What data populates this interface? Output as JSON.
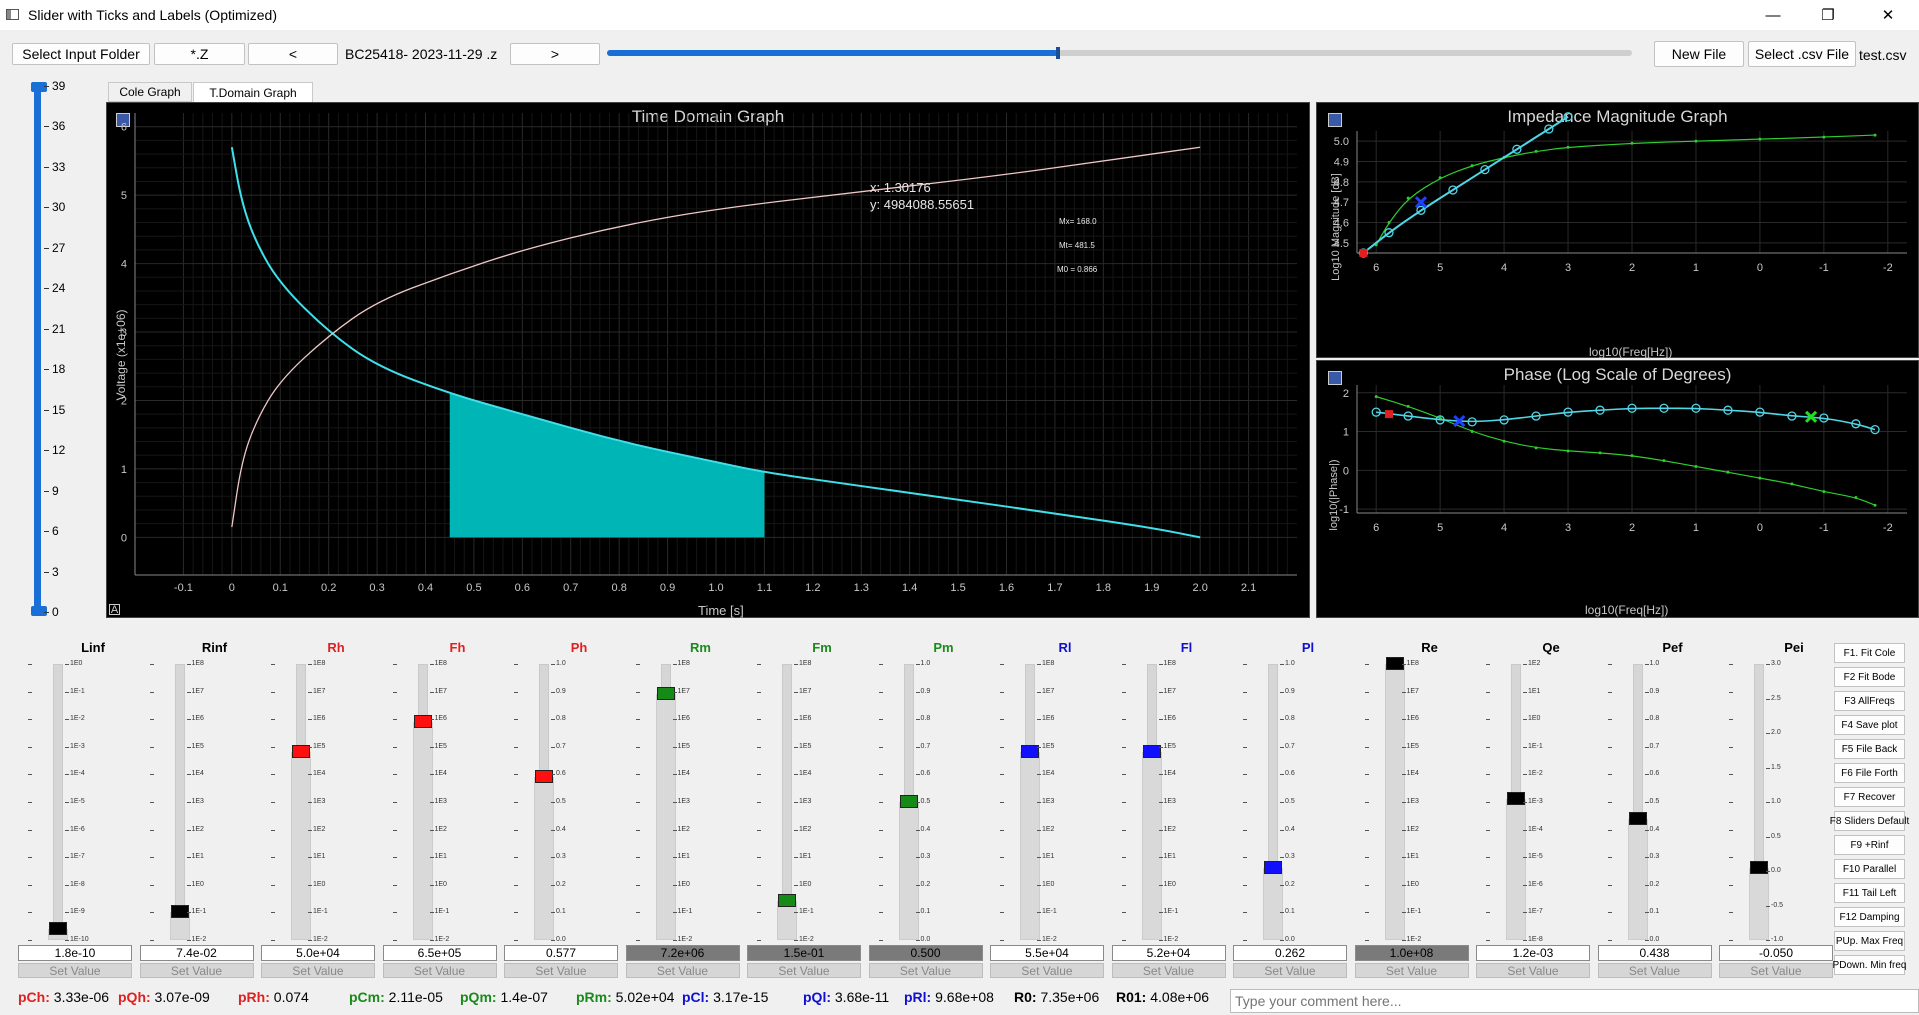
{
  "window": {
    "title": "Slider with Ticks and Labels (Optimized)",
    "minimize": "—",
    "maximize": "❐",
    "close": "✕"
  },
  "toolbar": {
    "select_input_folder": "Select Input Folder",
    "ext_z": "*.Z",
    "prev": "<",
    "file_name": "BC25418- 2023-11-29 .z",
    "next": ">",
    "file_progress": 0.44,
    "new_file": "New File",
    "select_csv": "Select .csv File",
    "csv_name": "test.csv"
  },
  "main_slider": {
    "ticks": [
      "39",
      "36",
      "33",
      "30",
      "27",
      "24",
      "21",
      "18",
      "15",
      "12",
      "9",
      "6",
      "3",
      "0"
    ],
    "value": 39
  },
  "tabs": [
    "Cole Graph",
    "T.Domain Graph"
  ],
  "time_graph": {
    "title": "Time Domain Graph",
    "xlabel": "Time [s]",
    "ylabel": "Voltage (x1e+06)",
    "cursor_x": "x: 1.30176",
    "cursor_y": "y: 4984088.55651",
    "note_mx": "Mx= 168.0",
    "note_mt": "Mt= 481.5",
    "note_m0": "M0 = 0.866",
    "xticks": [
      "-0.1",
      "0",
      "0.1",
      "0.2",
      "0.3",
      "0.4",
      "0.5",
      "0.6",
      "0.7",
      "0.8",
      "0.9",
      "1.0",
      "1.1",
      "1.2",
      "1.3",
      "1.4",
      "1.5",
      "1.6",
      "1.7",
      "1.8",
      "1.9",
      "2.0",
      "2.1"
    ],
    "yticks": [
      "0",
      "1",
      "2",
      "3",
      "4",
      "5",
      "6"
    ],
    "corner": "A"
  },
  "chart_data": [
    {
      "type": "line",
      "title": "Time Domain Graph",
      "xlabel": "Time [s]",
      "ylabel": "Voltage (x1e+06)",
      "xlim": [
        -0.2,
        2.2
      ],
      "ylim": [
        -0.55,
        6.2
      ],
      "series": [
        {
          "color": "#3fe0ea",
          "x": [
            0.0,
            0.02,
            0.05,
            0.1,
            0.2,
            0.3,
            0.45,
            0.6,
            0.8,
            1.0,
            1.1,
            1.3,
            1.5,
            1.7,
            1.9,
            2.0
          ],
          "y": [
            5.7,
            4.9,
            4.3,
            3.7,
            3.0,
            2.5,
            2.1,
            1.8,
            1.4,
            1.1,
            0.95,
            0.75,
            0.55,
            0.35,
            0.14,
            0.0
          ]
        },
        {
          "color": "#f0c8c8",
          "x": [
            0.0,
            0.02,
            0.05,
            0.1,
            0.2,
            0.3,
            0.45,
            0.6,
            0.8,
            1.0,
            1.3,
            1.6,
            1.8,
            2.0
          ],
          "y": [
            0.15,
            1.1,
            1.7,
            2.3,
            2.95,
            3.45,
            3.85,
            4.2,
            4.55,
            4.8,
            5.05,
            5.3,
            5.5,
            5.7
          ]
        }
      ],
      "shaded": {
        "x0": 0.45,
        "x1": 1.1,
        "color": "#00b5b5"
      }
    },
    {
      "type": "line",
      "title": "Impedance Magnitude Graph",
      "xlabel": "log10(Freq[Hz])",
      "ylabel": "Log10 Magnitude [dB]",
      "xlim": [
        6.3,
        -2.3
      ],
      "ylim": [
        4.45,
        5.05
      ],
      "series": [
        {
          "color": "#2ecc2e",
          "x": [
            6.0,
            5.8,
            5.5,
            5.0,
            4.5,
            4.0,
            3.5,
            3.0,
            2.0,
            1.0,
            0.0,
            -1.0,
            -1.8
          ],
          "y": [
            4.49,
            4.6,
            4.72,
            4.82,
            4.88,
            4.92,
            4.95,
            4.97,
            4.99,
            5.0,
            5.01,
            5.02,
            5.03
          ]
        },
        {
          "color": "#4fd7e8",
          "x": [
            6.2,
            5.8,
            5.3,
            4.8,
            4.3,
            3.8,
            3.3,
            3.0
          ],
          "y": [
            4.45,
            4.55,
            4.66,
            4.76,
            4.86,
            4.96,
            5.06,
            5.12
          ]
        }
      ]
    },
    {
      "type": "line",
      "title": "Phase (Log Scale of Degrees)",
      "xlabel": "log10(Freq[Hz])",
      "ylabel": "log10(|Phase|)",
      "xlim": [
        6.3,
        -2.3
      ],
      "ylim": [
        -1.1,
        2.2
      ],
      "series": [
        {
          "color": "#2ecc2e",
          "x": [
            6.0,
            5.5,
            5.0,
            4.5,
            4.0,
            3.5,
            3.0,
            2.5,
            2.0,
            1.5,
            1.0,
            0.5,
            0.0,
            -0.5,
            -1.0,
            -1.5,
            -1.8
          ],
          "y": [
            1.9,
            1.65,
            1.35,
            1.0,
            0.75,
            0.58,
            0.5,
            0.45,
            0.38,
            0.25,
            0.1,
            -0.05,
            -0.2,
            -0.35,
            -0.55,
            -0.7,
            -0.9
          ]
        },
        {
          "color": "#4fd7e8",
          "x": [
            6.0,
            5.5,
            5.0,
            4.5,
            4.0,
            3.5,
            3.0,
            2.5,
            2.0,
            1.5,
            1.0,
            0.5,
            0.0,
            -0.5,
            -1.0,
            -1.5,
            -1.8
          ],
          "y": [
            1.5,
            1.4,
            1.3,
            1.25,
            1.3,
            1.4,
            1.5,
            1.55,
            1.6,
            1.6,
            1.6,
            1.55,
            1.5,
            1.4,
            1.35,
            1.2,
            1.05
          ]
        }
      ]
    }
  ],
  "imp_graph": {
    "title": "Impedance Magnitude Graph",
    "xlabel": "log10(Freq[Hz])",
    "ylabel": "Log10 Magnitude [dB]",
    "xticks": [
      "6",
      "5",
      "4",
      "3",
      "2",
      "1",
      "0",
      "-1",
      "-2"
    ],
    "yticks": [
      "4.5",
      "4.6",
      "4.7",
      "4.8",
      "4.9",
      "5.0"
    ]
  },
  "phase_graph": {
    "title": "Phase (Log Scale of Degrees)",
    "xlabel": "log10(Freq[Hz])",
    "ylabel": "log10(|Phase|)",
    "xticks": [
      "6",
      "5",
      "4",
      "3",
      "2",
      "1",
      "0",
      "-1",
      "-2"
    ],
    "yticks": [
      "2",
      "1",
      "0",
      "-1"
    ]
  },
  "params": [
    {
      "name": "Linf",
      "color": "#000000",
      "handle": "#000000",
      "pos": 0.96,
      "value": "1.8e-10",
      "dark": false,
      "labels": [
        "1E0",
        "1E-1",
        "1E-2",
        "1E-3",
        "1E-4",
        "1E-5",
        "1E-6",
        "1E-7",
        "1E-8",
        "1E-9",
        "1E-10"
      ]
    },
    {
      "name": "Rinf",
      "color": "#000000",
      "handle": "#000000",
      "pos": 0.9,
      "value": "7.4e-02",
      "dark": false,
      "labels": [
        "1E8",
        "1E7",
        "1E6",
        "1E5",
        "1E4",
        "1E3",
        "1E2",
        "1E1",
        "1E0",
        "1E-1",
        "1E-2"
      ]
    },
    {
      "name": "Rh",
      "color": "#e02020",
      "handle": "#ff1010",
      "pos": 0.32,
      "value": "5.0e+04",
      "dark": false,
      "labels": [
        "1E8",
        "1E7",
        "1E6",
        "1E5",
        "1E4",
        "1E3",
        "1E2",
        "1E1",
        "1E0",
        "1E-1",
        "1E-2"
      ]
    },
    {
      "name": "Fh",
      "color": "#e02020",
      "handle": "#ff1010",
      "pos": 0.21,
      "value": "6.5e+05",
      "dark": false,
      "labels": [
        "1E8",
        "1E7",
        "1E6",
        "1E5",
        "1E4",
        "1E3",
        "1E2",
        "1E1",
        "1E0",
        "1E-1",
        "1E-2"
      ]
    },
    {
      "name": "Ph",
      "color": "#e02020",
      "handle": "#ff1010",
      "pos": 0.41,
      "value": "0.577",
      "dark": false,
      "labels": [
        "1.0",
        "0.9",
        "0.8",
        "0.7",
        "0.6",
        "0.5",
        "0.4",
        "0.3",
        "0.2",
        "0.1",
        "0.0"
      ]
    },
    {
      "name": "Rm",
      "color": "#1a8a1a",
      "handle": "#168a16",
      "pos": 0.11,
      "value": "7.2e+06",
      "dark": true,
      "labels": [
        "1E8",
        "1E7",
        "1E6",
        "1E5",
        "1E4",
        "1E3",
        "1E2",
        "1E1",
        "1E0",
        "1E-1",
        "1E-2"
      ]
    },
    {
      "name": "Fm",
      "color": "#1a8a1a",
      "handle": "#168a16",
      "pos": 0.86,
      "value": "1.5e-01",
      "dark": true,
      "labels": [
        "1E8",
        "1E7",
        "1E6",
        "1E5",
        "1E4",
        "1E3",
        "1E2",
        "1E1",
        "1E0",
        "1E-1",
        "1E-2"
      ]
    },
    {
      "name": "Pm",
      "color": "#1a8a1a",
      "handle": "#168a16",
      "pos": 0.5,
      "value": "0.500",
      "dark": true,
      "labels": [
        "1.0",
        "0.9",
        "0.8",
        "0.7",
        "0.6",
        "0.5",
        "0.4",
        "0.3",
        "0.2",
        "0.1",
        "0.0"
      ]
    },
    {
      "name": "Rl",
      "color": "#1010d0",
      "handle": "#1010ff",
      "pos": 0.32,
      "value": "5.5e+04",
      "dark": false,
      "labels": [
        "1E8",
        "1E7",
        "1E6",
        "1E5",
        "1E4",
        "1E3",
        "1E2",
        "1E1",
        "1E0",
        "1E-1",
        "1E-2"
      ]
    },
    {
      "name": "Fl",
      "color": "#1010d0",
      "handle": "#1010ff",
      "pos": 0.32,
      "value": "5.2e+04",
      "dark": false,
      "labels": [
        "1E8",
        "1E7",
        "1E6",
        "1E5",
        "1E4",
        "1E3",
        "1E2",
        "1E1",
        "1E0",
        "1E-1",
        "1E-2"
      ]
    },
    {
      "name": "Pl",
      "color": "#1010d0",
      "handle": "#1010ff",
      "pos": 0.74,
      "value": "0.262",
      "dark": false,
      "labels": [
        "1.0",
        "0.9",
        "0.8",
        "0.7",
        "0.6",
        "0.5",
        "0.4",
        "0.3",
        "0.2",
        "0.1",
        "0.0"
      ]
    },
    {
      "name": "Re",
      "color": "#000000",
      "handle": "#000000",
      "pos": 0.0,
      "value": "1.0e+08",
      "dark": true,
      "labels": [
        "1E8",
        "1E7",
        "1E6",
        "1E5",
        "1E4",
        "1E3",
        "1E2",
        "1E1",
        "1E0",
        "1E-1",
        "1E-2"
      ]
    },
    {
      "name": "Qe",
      "color": "#000000",
      "handle": "#000000",
      "pos": 0.49,
      "value": "1.2e-03",
      "dark": false,
      "labels": [
        "1E2",
        "1E1",
        "1E0",
        "1E-1",
        "1E-2",
        "1E-3",
        "1E-4",
        "1E-5",
        "1E-6",
        "1E-7",
        "1E-8"
      ]
    },
    {
      "name": "Pef",
      "color": "#000000",
      "handle": "#000000",
      "pos": 0.56,
      "value": "0.438",
      "dark": false,
      "labels": [
        "1.0",
        "0.9",
        "0.8",
        "0.7",
        "0.6",
        "0.5",
        "0.4",
        "0.3",
        "0.2",
        "0.1",
        "0.0"
      ]
    },
    {
      "name": "Pei",
      "color": "#000000",
      "handle": "#000000",
      "pos": 0.74,
      "value": "-0.050",
      "dark": false,
      "labels": [
        "3.0",
        "2.5",
        "2.0",
        "1.5",
        "1.0",
        "0.5",
        "0.0",
        "-0.5",
        "-1.0"
      ]
    }
  ],
  "set_value_label": "Set Value",
  "function_keys": [
    "F1. Fit Cole",
    "F2 Fit Bode",
    "F3 AllFreqs",
    "F4 Save plot",
    "F5 File Back",
    "F6 File Forth",
    "F7 Recover",
    "F8 Sliders Default",
    "F9 +Rinf",
    "F10 Parallel",
    "F11 Tail Left",
    "F12 Damping",
    "PUp. Max Freq",
    "PDown. Min freq"
  ],
  "stats": [
    {
      "label": "pCh:",
      "value": "3.33e-06",
      "color": "#e02020"
    },
    {
      "label": "pQh:",
      "value": "3.07e-09",
      "color": "#e02020"
    },
    {
      "label": "pRh:",
      "value": "0.074",
      "color": "#e02020"
    },
    {
      "label": "pCm:",
      "value": "2.11e-05",
      "color": "#1a8a1a"
    },
    {
      "label": "pQm:",
      "value": "1.4e-07",
      "color": "#1a8a1a"
    },
    {
      "label": "pRm:",
      "value": "5.02e+04",
      "color": "#1a8a1a"
    },
    {
      "label": "pCl:",
      "value": "3.17e-15",
      "color": "#1010d0"
    },
    {
      "label": "pQl:",
      "value": "3.68e-11",
      "color": "#1010d0"
    },
    {
      "label": "pRl:",
      "value": "9.68e+08",
      "color": "#1010d0"
    },
    {
      "label": "R0:",
      "value": "7.35e+06",
      "color": "#000000"
    },
    {
      "label": "R01:",
      "value": "4.08e+06",
      "color": "#000000"
    }
  ],
  "comment_placeholder": "Type your comment here..."
}
